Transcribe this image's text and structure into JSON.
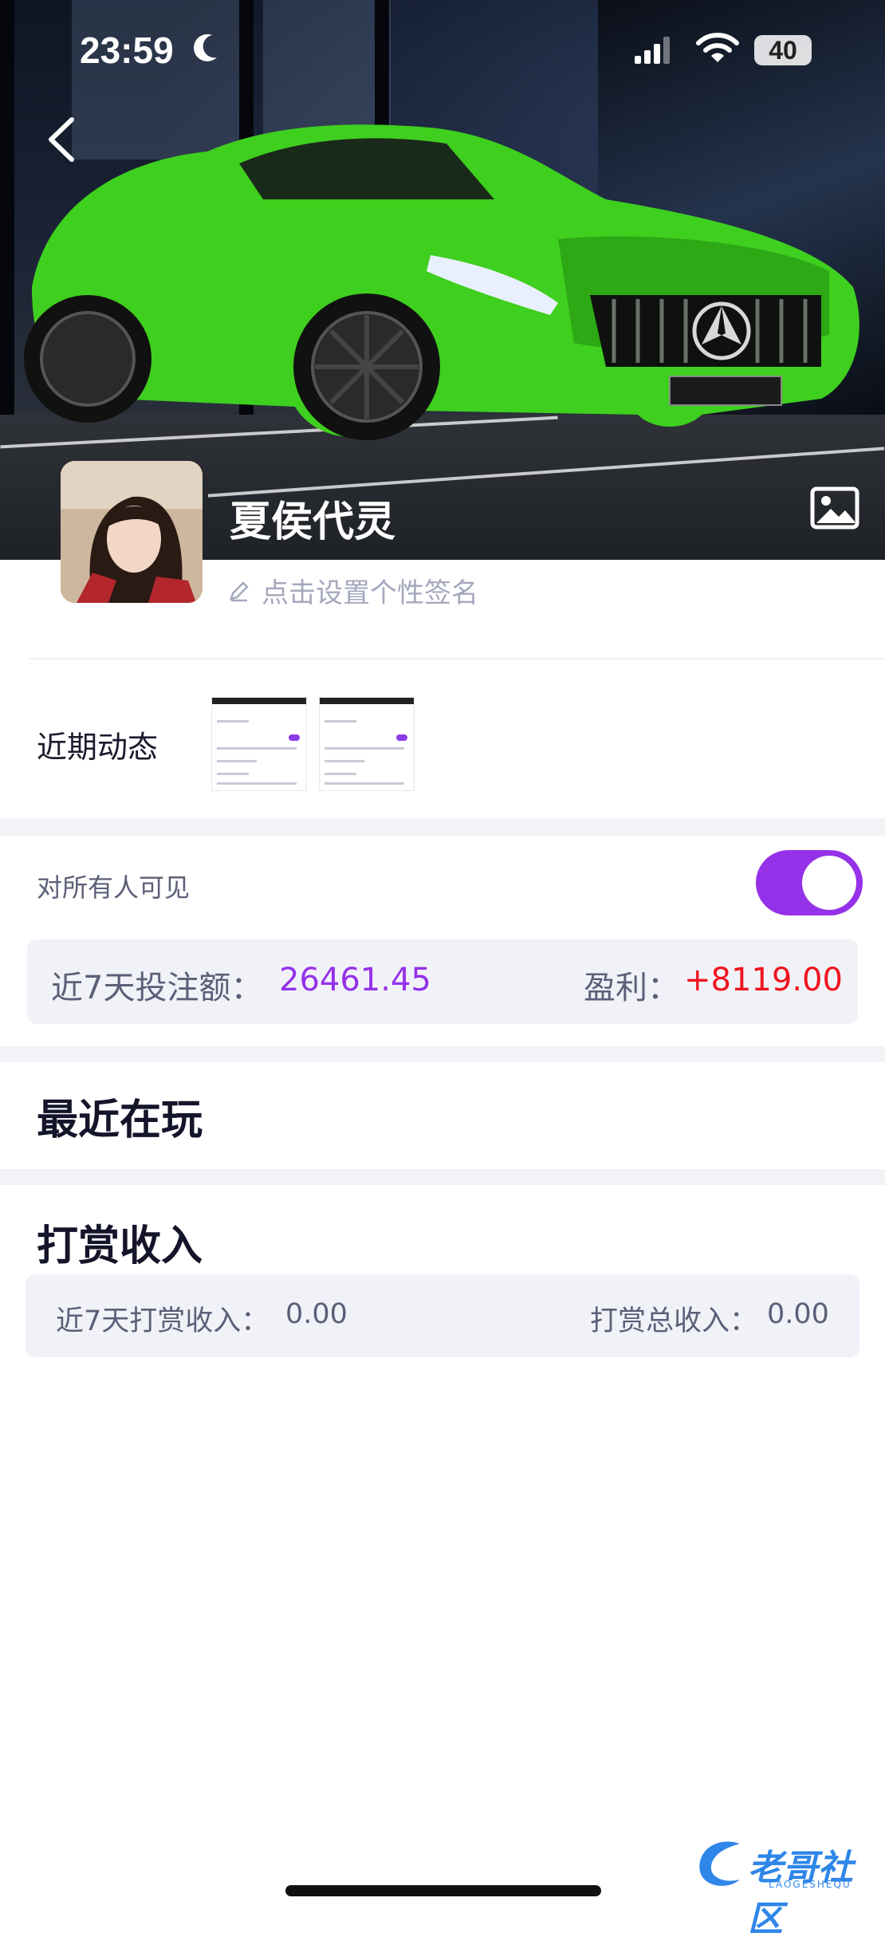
{
  "status_bar": {
    "time": "23:59",
    "battery": "40"
  },
  "profile": {
    "name": "夏侯代灵",
    "signature_placeholder": "点击设置个性签名"
  },
  "recent": {
    "label": "近期动态"
  },
  "visibility": {
    "label": "对所有人可见",
    "enabled": true
  },
  "stats": {
    "bet_label": "近7天投注额：",
    "bet_value": "26461.45",
    "profit_label": "盈利：",
    "profit_value": "+8119.00"
  },
  "recently_playing": {
    "title": "最近在玩"
  },
  "rewards": {
    "title": "打赏收入",
    "week_label": "近7天打赏收入：",
    "week_value": "0.00",
    "total_label": "打赏总收入：",
    "total_value": "0.00"
  },
  "watermark": {
    "text": "老哥社区",
    "sub": "LAOGESHEQU"
  },
  "colors": {
    "accent_purple": "#9531e8",
    "profit_red": "#f0141e",
    "car_green": "#3fcf1f"
  },
  "icons": [
    "moon-icon",
    "signal-icon",
    "wifi-icon",
    "back-arrow-icon",
    "image-icon",
    "pencil-icon"
  ]
}
